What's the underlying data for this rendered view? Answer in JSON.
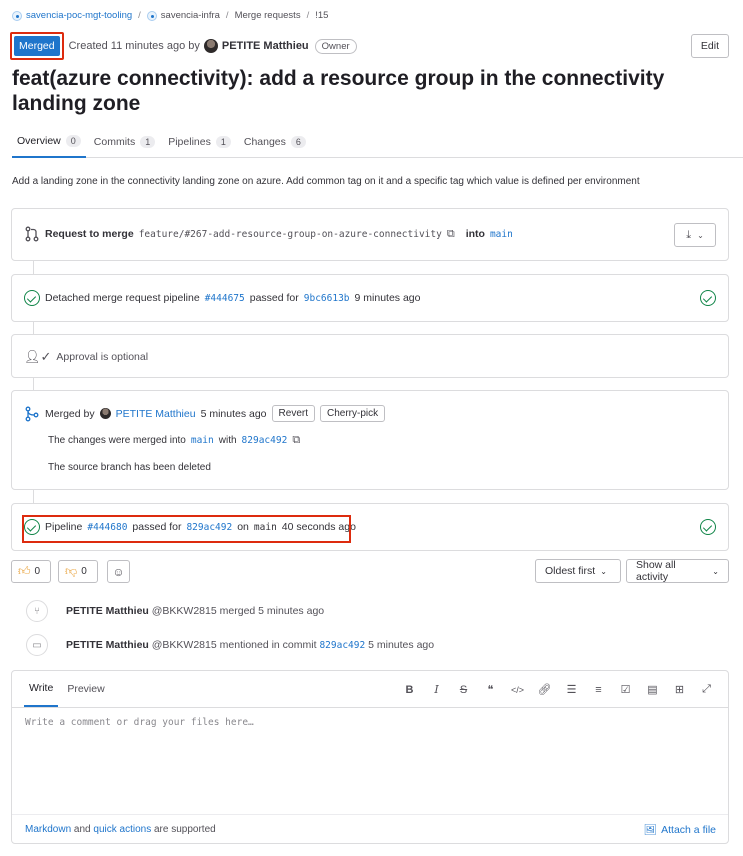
{
  "breadcrumb": {
    "items": [
      "savencia-poc-mgt-tooling",
      "savencia-infra",
      "Merge requests",
      "!15"
    ],
    "separator": "/"
  },
  "header": {
    "status": "Merged",
    "created_text": "Created 11 minutes ago by",
    "author": "PETITE Matthieu",
    "role": "Owner",
    "edit_label": "Edit"
  },
  "title": "feat(azure connectivity): add a resource group in the connectivity landing zone",
  "tabs": [
    {
      "label": "Overview",
      "count": "0"
    },
    {
      "label": "Commits",
      "count": "1"
    },
    {
      "label": "Pipelines",
      "count": "1"
    },
    {
      "label": "Changes",
      "count": "6"
    }
  ],
  "description": "Add a landing zone in the connectivity landing zone on azure. Add common tag on it and a specific tag which value is defined per environment",
  "merge_request": {
    "label": "Request to merge",
    "source_branch": "feature/#267-add-resource-group-on-azure-connectivity",
    "into": "into",
    "target_branch": "main"
  },
  "detached_pipeline": {
    "prefix": "Detached merge request pipeline",
    "pipeline_id": "#444675",
    "passed_for": "passed for",
    "commit": "9bc6613b",
    "time": "9 minutes ago"
  },
  "approval": {
    "text": "Approval is optional"
  },
  "merged": {
    "prefix": "Merged by",
    "author": "PETITE Matthieu",
    "time": "5 minutes ago",
    "revert": "Revert",
    "cherry_pick": "Cherry-pick",
    "changes_prefix": "The changes were merged into",
    "branch": "main",
    "with": "with",
    "commit": "829ac492",
    "source_deleted": "The source branch has been deleted"
  },
  "main_pipeline": {
    "prefix": "Pipeline",
    "pipeline_id": "#444680",
    "passed_for": "passed for",
    "commit": "829ac492",
    "on": "on",
    "branch": "main",
    "time": "40 seconds ago"
  },
  "reactions": {
    "thumbs_up": "0",
    "thumbs_down": "0"
  },
  "sort": {
    "order": "Oldest first",
    "filter": "Show all activity"
  },
  "activity": [
    {
      "name": "PETITE Matthieu",
      "handle": "@BKKW2815",
      "text": "merged 5 minutes ago"
    },
    {
      "name": "PETITE Matthieu",
      "handle": "@BKKW2815",
      "text": "mentioned in commit",
      "commit": "829ac492",
      "time": "5 minutes ago"
    }
  ],
  "editor": {
    "write_tab": "Write",
    "preview_tab": "Preview",
    "placeholder": "Write a comment or drag your files here…",
    "footer_link1": "Markdown",
    "footer_and": "and",
    "footer_link2": "quick actions",
    "footer_suffix": "are supported",
    "attach": "Attach a file"
  },
  "colors": {
    "accent": "#1f75cb",
    "success": "#108548",
    "highlight": "#dd2b0e"
  }
}
